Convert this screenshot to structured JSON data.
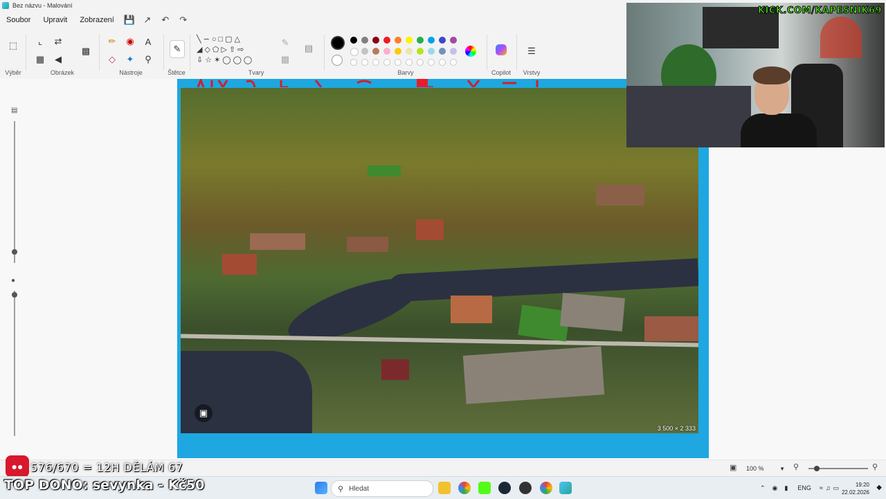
{
  "window": {
    "title": "Bez názvu - Malování"
  },
  "menu": {
    "items": [
      "Soubor",
      "Upravit",
      "Zobrazení"
    ]
  },
  "ribbon": {
    "groups": {
      "select": "Výběr",
      "image": "Obrázek",
      "tools": "Nástroje",
      "brushes": "Štětce",
      "shapes": "Tvary",
      "colors": "Barvy",
      "copilot": "Copilot",
      "layers": "Vrstvy"
    },
    "palette_row1": [
      "#000000",
      "#7f7f7f",
      "#880015",
      "#ed1c24",
      "#ff7f27",
      "#fff200",
      "#22b14c",
      "#00a2e8",
      "#3f48cc",
      "#a349a4"
    ],
    "palette_row2": [
      "#ffffff",
      "#c3c3c3",
      "#b97a57",
      "#ffaec9",
      "#ffc90e",
      "#efe4b0",
      "#b5e61d",
      "#99d9ea",
      "#7092be",
      "#c8bfe7"
    ],
    "primary_color": "#000000",
    "secondary_color": "#ffffff"
  },
  "canvas": {
    "background_color": "#1ea7e0",
    "image_dimensions": "3 500 × 2 333"
  },
  "statusbar": {
    "zoom": "100 %"
  },
  "stream": {
    "kick_url": "KICK.COM/KAPESNIK69",
    "counter": "576/670 = 12H DĚLÁM 67",
    "top_dono": "TOP DONO: sevynka - Kč50"
  },
  "taskbar": {
    "search_placeholder": "Hledat",
    "language": "ENG",
    "time": "19:20",
    "date": "22.02.2026"
  }
}
